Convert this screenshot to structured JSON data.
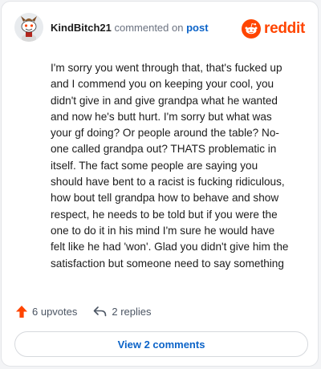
{
  "header": {
    "username": "KindBitch21",
    "action_text": "commented on",
    "post_link": "post",
    "brand_name": "reddit",
    "brand_color": "#ff4500",
    "avatar_icon": "snoo-avatar-icon"
  },
  "comment": {
    "body": "I'm sorry you went through that, that's fucked up\nand I commend you on keeping your cool, you\ndidn't give in and give grandpa what he wanted\nand now he's butt hurt. I'm sorry but what was\nyour gf doing? Or people around the table? No-\none called grandpa out? THATS problematic in\nitself. The fact some people are saying you\nshould have bent to a racist is fucking ridiculous,\nhow bout tell grandpa how to behave and show\nrespect, he needs to be told but if you were the\none to do it in his mind I'm sure he would have\nfelt like he had 'won'. Glad you didn't give him the\nsatisfaction but someone need to say something"
  },
  "stats": {
    "upvotes": "6 upvotes",
    "replies": "2 replies",
    "upvote_icon": "upvote-arrow-icon",
    "reply_icon": "reply-arrow-icon"
  },
  "footer": {
    "view_comments": "View 2 comments"
  },
  "colors": {
    "upvote": "#ff4500",
    "link": "#0b63c8",
    "text": "#1c1c1c",
    "muted": "#6b7280"
  }
}
